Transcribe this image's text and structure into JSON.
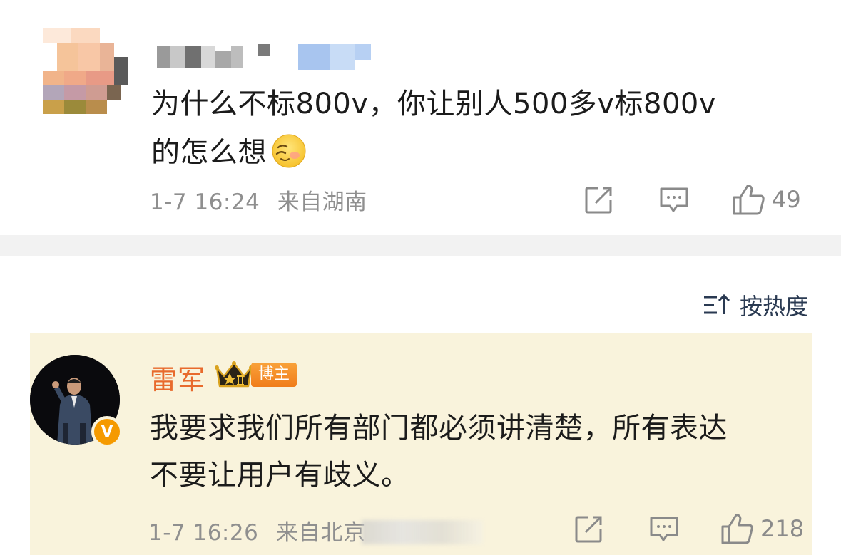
{
  "comment": {
    "text_line1": "为什么不标800v，你让别人500多v标800v",
    "text_line2": "的怎么想",
    "emoji": "sleepy-face-emoji",
    "time": "1-7 16:24",
    "location": "来自湖南",
    "like_count": "49",
    "icons": {
      "share": "share-icon",
      "comment": "comment-icon",
      "like": "like-icon"
    }
  },
  "sort": {
    "label": "按热度",
    "icon": "sort-icon"
  },
  "reply": {
    "author": "雷军",
    "badge_label": "博主",
    "text_line1": "我要求我们所有部门都必须讲清楚，所有表达",
    "text_line2": "不要让用户有歧义。",
    "time": "1-7 16:26",
    "location": "来自北京",
    "like_count": "218",
    "verified": "V",
    "highlight_color": "#f9f3dc",
    "author_color": "#e86a2d"
  }
}
